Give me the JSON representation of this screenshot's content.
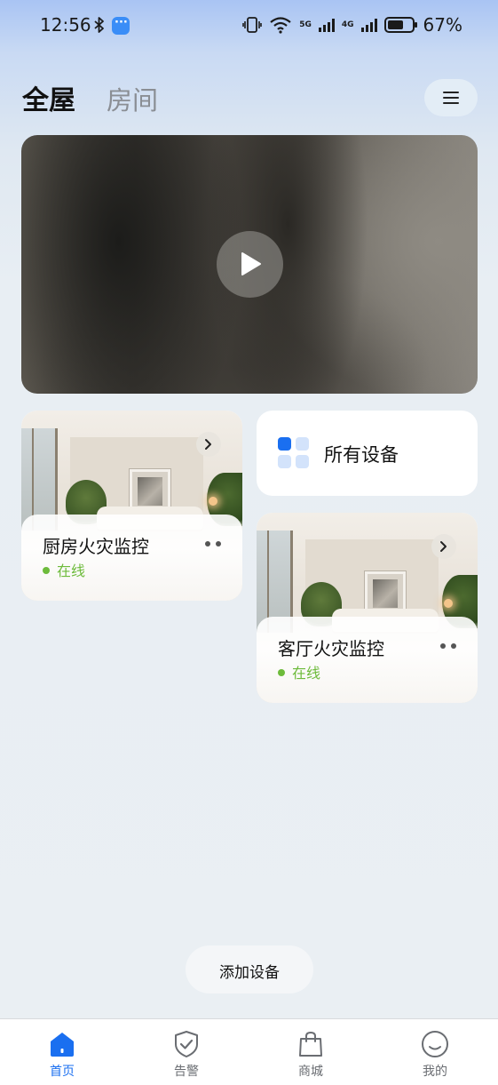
{
  "status_bar": {
    "time": "12:56",
    "net1": "5G",
    "net2": "4G",
    "battery": "67%",
    "battery_level": 0.67
  },
  "header": {
    "tab_whole_house": "全屋",
    "tab_rooms": "房间"
  },
  "video": {
    "play_icon": "play-icon"
  },
  "all_devices": {
    "label": "所有设备",
    "icon": "grid-icon",
    "accent": "#1a6ff0"
  },
  "devices": [
    {
      "name": "厨房火灾监控",
      "status": "在线"
    },
    {
      "name": "客厅火灾监控",
      "status": "在线"
    }
  ],
  "add_device": {
    "label": "添加设备"
  },
  "tabbar": {
    "items": [
      {
        "label": "首页",
        "icon": "home-icon",
        "active": true
      },
      {
        "label": "告警",
        "icon": "shield-check-icon",
        "active": false
      },
      {
        "label": "商城",
        "icon": "shopping-bag-icon",
        "active": false
      },
      {
        "label": "我的",
        "icon": "smiley-icon",
        "active": false
      }
    ]
  },
  "colors": {
    "online": "#6dbb3b",
    "active_tab": "#1a6ff0",
    "inactive_tab": "#6a6d72"
  }
}
